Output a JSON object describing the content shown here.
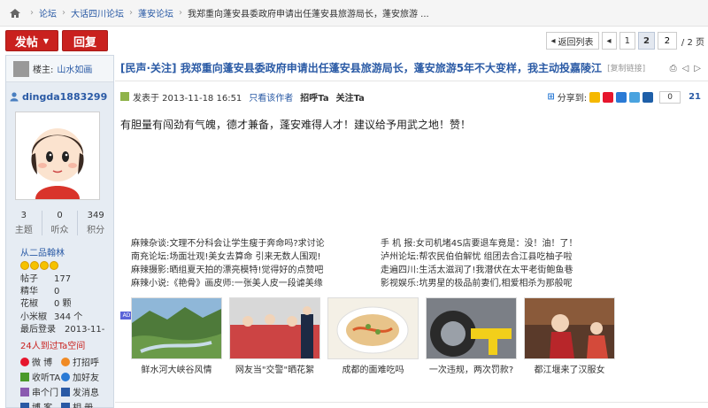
{
  "breadcrumb": {
    "items": [
      "论坛",
      "大话四川论坛",
      "蓬安论坛",
      "我郑重向蓬安县委政府申请出任蓬安县旅游局长，蓬安旅游 ..."
    ]
  },
  "toolbar": {
    "post_label": "发帖",
    "reply_label": "回复"
  },
  "pager": {
    "back_label": "返回列表",
    "pages": [
      "1",
      "2"
    ],
    "current_page": "2",
    "input_value": "2",
    "total": "/ 2 页"
  },
  "author": {
    "owner_label": "楼主:",
    "owner_name": "山水如画",
    "username": "dingda1883299",
    "stats": [
      {
        "n": "3",
        "l": "主题"
      },
      {
        "n": "0",
        "l": "听众"
      },
      {
        "n": "349",
        "l": "积分"
      }
    ],
    "rank": "从二品翰林",
    "info": [
      {
        "k": "帖子",
        "v": "177"
      },
      {
        "k": "精华",
        "v": "0"
      },
      {
        "k": "花椒",
        "v": "0 颗"
      },
      {
        "k": "小米椒",
        "v": "344 个"
      },
      {
        "k": "最后登录",
        "v": "2013-11-"
      }
    ],
    "space_link": "24人到过Ta空间",
    "links": [
      {
        "icon": "weibo-icon",
        "label": "微 博",
        "color": "#e6162d"
      },
      {
        "icon": "greet-icon",
        "label": "打招呼",
        "color": "#f08a24"
      },
      {
        "icon": "gift-icon",
        "label": "收听TA",
        "color": "#4a9a2a"
      },
      {
        "icon": "friend-icon",
        "label": "加好友",
        "color": "#2a7ad5"
      },
      {
        "icon": "message-icon",
        "label": "串个门",
        "color": "#8a5ab0"
      },
      {
        "icon": "mail-icon",
        "label": "发消息",
        "color": "#2a5aa5"
      },
      {
        "icon": "blog-icon",
        "label": "博 客",
        "color": "#2a5aa5"
      },
      {
        "icon": "album-icon",
        "label": "相 册",
        "color": "#2a5aa5"
      }
    ]
  },
  "post": {
    "title": "[民声·关注] 我郑重向蓬安县委政府申请出任蓬安县旅游局长，蓬安旅游5年不大变样，我主动投嘉陵江",
    "copy_link": "[复制链接]",
    "published": "发表于 2013-11-18 16:51",
    "only_author": "只看该作者",
    "greet": "招呼Ta",
    "follow": "关注Ta",
    "share_label": "分享到:",
    "share_count": "0",
    "floor": "21",
    "content": "有胆量有闯劲有气魄，德才兼备，蓬安难得人才！建议给予用武之地！赞！"
  },
  "ads": {
    "left": [
      {
        "k": "麻辣杂谈:",
        "t": "文理不分科会让学生瘦于奔命吗?求讨论"
      },
      {
        "k": "南充论坛:",
        "t": "场面壮观!美女去算命 引来无数人围观!"
      },
      {
        "k": "麻辣摄影:",
        "t": "晒组夏天拍的漂亮模特!觉得好的点赞吧"
      },
      {
        "k": "麻辣小说:",
        "t": "《艳骨》画皮师:一张美人皮一段谑美缘"
      }
    ],
    "right": [
      {
        "k": "手 机 报:",
        "t": "女司机堵4S店要退车竟是：没！油！了！"
      },
      {
        "k": "泸州论坛:",
        "t": "帮农民伯伯解忧 组团去合江县吃柚子啦"
      },
      {
        "k": "走遍四川:",
        "t": "生活太滋润了!我潜伏在太平老街鲍鱼巷"
      },
      {
        "k": "影视娱乐:",
        "t": "坑男星的极品前妻们,相爱相杀为那般呢"
      }
    ]
  },
  "ad_tag": "AD",
  "pictures": [
    {
      "cap": "鲜水河大峡谷风情"
    },
    {
      "cap": "网友当\"交警\"晒花絮"
    },
    {
      "cap": "成都的面难吃吗"
    },
    {
      "cap": "一次违规，两次罚款?"
    },
    {
      "cap": "都江堰来了汉服女"
    }
  ]
}
